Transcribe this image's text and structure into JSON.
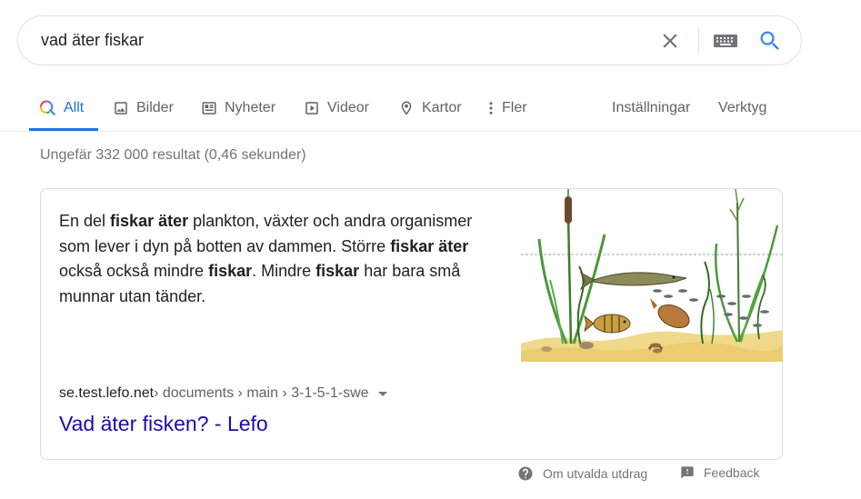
{
  "search": {
    "query": "vad äter fiskar"
  },
  "tabs": [
    {
      "label": "Allt",
      "icon": "search-multicolor-icon",
      "active": true
    },
    {
      "label": "Bilder",
      "icon": "image-icon"
    },
    {
      "label": "Nyheter",
      "icon": "newspaper-icon"
    },
    {
      "label": "Videor",
      "icon": "video-play-icon"
    },
    {
      "label": "Kartor",
      "icon": "map-pin-icon"
    },
    {
      "label": "Fler",
      "icon": "more-vert-icon"
    }
  ],
  "tools": {
    "settings_label": "Inställningar",
    "tools_label": "Verktyg"
  },
  "result_stats": "Ungefär 332 000 resultat (0,46 sekunder)",
  "featured_snippet": {
    "text_parts": [
      {
        "text": "En del ",
        "bold": false
      },
      {
        "text": "fiskar äter",
        "bold": true
      },
      {
        "text": " plankton, växter och andra organismer som lever i dyn på botten av dammen. Större ",
        "bold": false
      },
      {
        "text": "fiskar äter",
        "bold": true
      },
      {
        "text": " också också mindre ",
        "bold": false
      },
      {
        "text": "fiskar",
        "bold": true
      },
      {
        "text": ". Mindre ",
        "bold": false
      },
      {
        "text": "fiskar",
        "bold": true
      },
      {
        "text": " har bara små munnar utan tänder.",
        "bold": false
      }
    ],
    "image_description_icon": "pond-illustration",
    "breadcrumb": {
      "domain": "se.test.lefo.net",
      "path": " › documents › main › 3-1-5-1-swe"
    },
    "title": "Vad äter fisken? - Lefo"
  },
  "footer": {
    "about_label": "Om utvalda utdrag",
    "feedback_label": "Feedback"
  },
  "colors": {
    "accent": "#1a73e8",
    "link": "#1a0dab",
    "muted": "#70757a"
  }
}
